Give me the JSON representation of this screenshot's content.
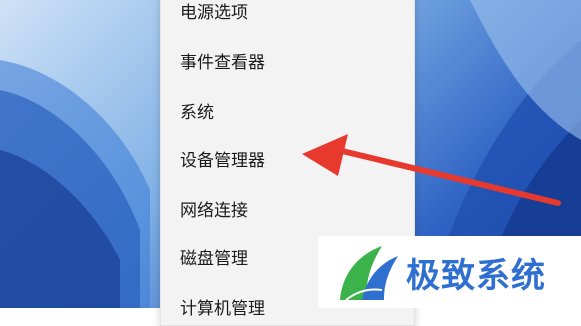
{
  "menu": {
    "items": [
      {
        "label": "电源选项"
      },
      {
        "label": "事件查看器"
      },
      {
        "label": "系统"
      },
      {
        "label": "设备管理器"
      },
      {
        "label": "网络连接"
      },
      {
        "label": "磁盘管理"
      },
      {
        "label": "计算机管理"
      }
    ]
  },
  "watermark": {
    "text": "极致系统"
  },
  "colors": {
    "arrow": "#e8392f",
    "watermark_text": "#2f6fd0",
    "menu_bg": "#f3f3f3"
  }
}
